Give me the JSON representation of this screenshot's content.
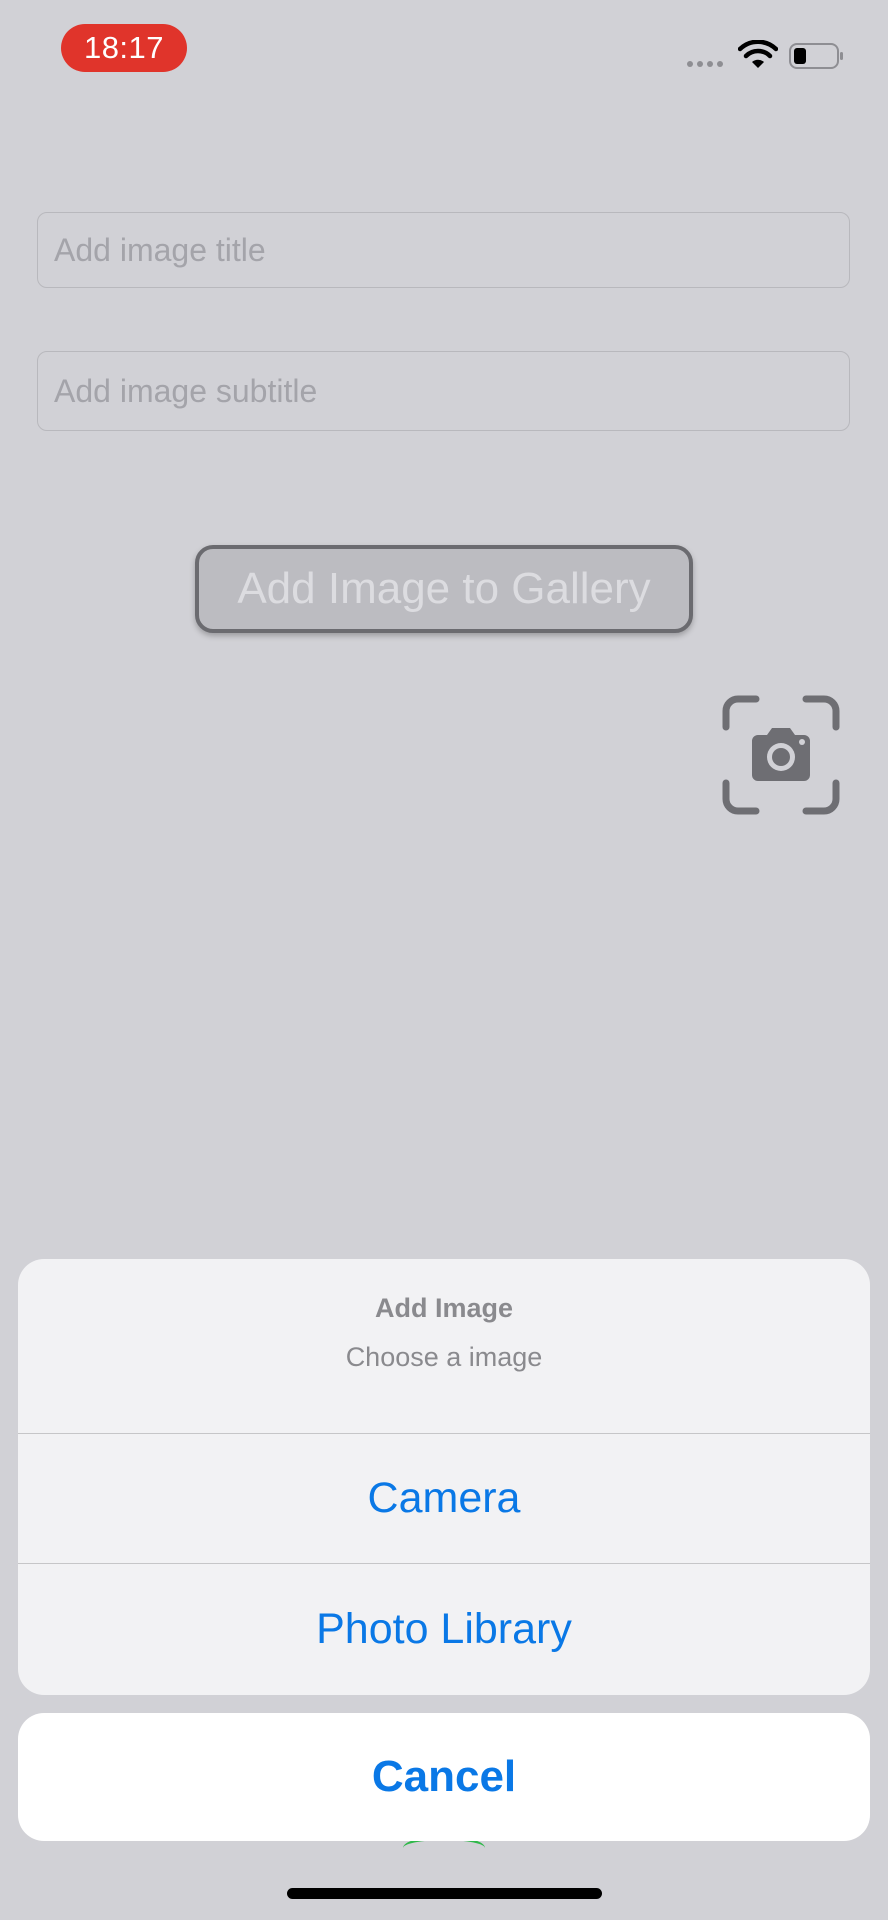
{
  "status_bar": {
    "time": "18:17",
    "icons": [
      "cellular-signal-icon",
      "wifi-icon",
      "battery-icon"
    ]
  },
  "form": {
    "title_placeholder": "Add image title",
    "title_value": "",
    "subtitle_placeholder": "Add image subtitle",
    "subtitle_value": "",
    "add_button_label": "Add Image to Gallery",
    "camera_icon": "camera-viewfinder-icon"
  },
  "action_sheet": {
    "title": "Add Image",
    "message": "Choose a image",
    "actions": [
      {
        "label": "Camera"
      },
      {
        "label": "Photo Library"
      }
    ],
    "cancel_label": "Cancel"
  },
  "colors": {
    "dimmed_background": "#d1d1d6",
    "action_blue": "#0a78e6",
    "time_pill_red": "#e0342b"
  }
}
